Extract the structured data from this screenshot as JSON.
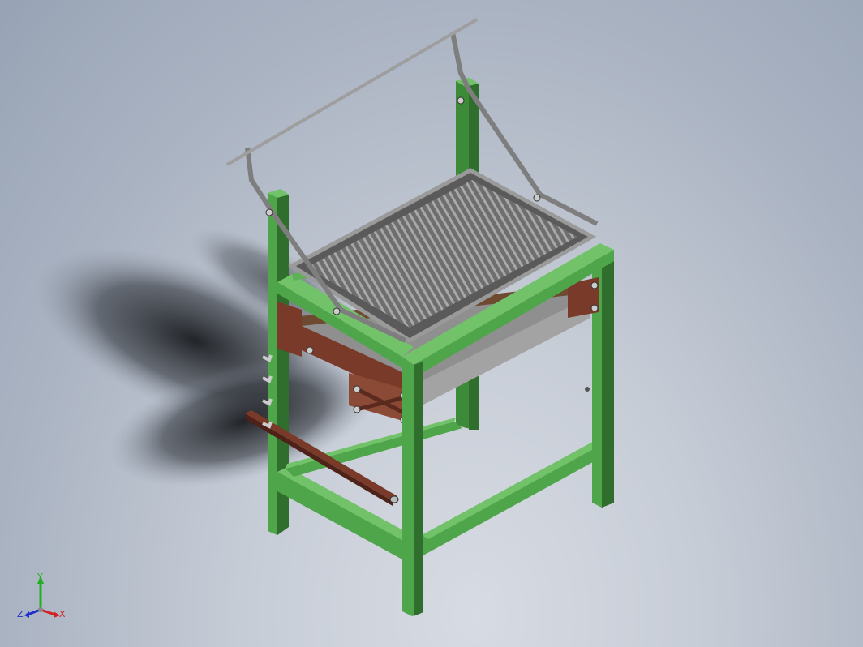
{
  "triad": {
    "x_label": "X",
    "y_label": "Y",
    "z_label": "Z",
    "x_color": "#d42020",
    "y_color": "#20b020",
    "z_color": "#2030c8"
  },
  "colors": {
    "frame": "#4fa64a",
    "frame_dark": "#2f6e2c",
    "frame_light": "#72c26a",
    "grill": "#8c8c8c",
    "rod": "#8a8a8a",
    "mechanism": "#7a3a2a",
    "tray": "#9a9a9a"
  }
}
